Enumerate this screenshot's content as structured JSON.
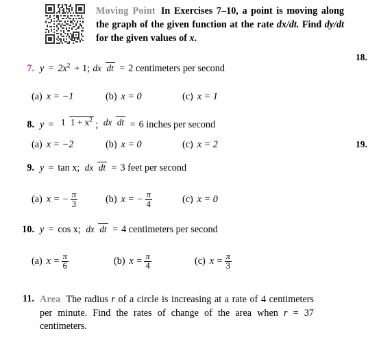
{
  "header": {
    "qr_alt": "qr-code",
    "category_label": "Moving Point",
    "line1_rest": "In Exercises 7–10, a point is",
    "line2": "moving along the graph of the given function at",
    "line3_a": "the rate ",
    "line3_math1": "dx/dt.",
    "line3_b": " Find ",
    "line3_math2": "dy/dt",
    "line3_c": " for the given values of ",
    "line3_var": "x",
    "line3_end": "."
  },
  "margin_numbers": {
    "first": "18.",
    "second": "19."
  },
  "exercises": [
    {
      "number": "7.",
      "y_label": "y",
      "equals": "=",
      "rhs": "2x",
      "exponent": "2",
      "plus_one": "+ 1;",
      "rate_num": "dx",
      "rate_den": "dt",
      "rate_equals": "=",
      "rate_value": "2 centimeters per second",
      "choices": [
        {
          "tag": "(a)",
          "expr": "x = −1"
        },
        {
          "tag": "(b)",
          "expr": "x = 0"
        },
        {
          "tag": "(c)",
          "expr": "x = 1"
        }
      ]
    },
    {
      "number": "8.",
      "y_label": "y",
      "equals": "=",
      "frac_num": "1",
      "frac_den": "1 + x",
      "frac_den_exp": "2",
      "semicolon": ";",
      "rate_num": "dx",
      "rate_den": "dt",
      "rate_equals": "=",
      "rate_value": "6 inches per second",
      "choices": [
        {
          "tag": "(a)",
          "expr": "x = −2"
        },
        {
          "tag": "(b)",
          "expr": "x = 0"
        },
        {
          "tag": "(c)",
          "expr": "x = 2"
        }
      ]
    },
    {
      "number": "9.",
      "y_label": "y",
      "equals": "=",
      "rhs": "tan x;",
      "rate_num": "dx",
      "rate_den": "dt",
      "rate_equals": "=",
      "rate_value": "3 feet per second",
      "choices": [
        {
          "tag": "(a)",
          "lead": "x = −",
          "num": "π",
          "den": "3"
        },
        {
          "tag": "(b)",
          "lead": "x = −",
          "num": "π",
          "den": "4"
        },
        {
          "tag": "(c)",
          "plain": "x = 0"
        }
      ]
    },
    {
      "number": "10.",
      "y_label": "y",
      "equals": "=",
      "rhs": "cos x;",
      "rate_num": "dx",
      "rate_den": "dt",
      "rate_equals": "=",
      "rate_value": "4 centimeters per second",
      "choices": [
        {
          "tag": "(a)",
          "lead": "x =",
          "num": "π",
          "den": "6"
        },
        {
          "tag": "(b)",
          "lead": "x =",
          "num": "π",
          "den": "4"
        },
        {
          "tag": "(c)",
          "lead": "x =",
          "num": "π",
          "den": "3"
        }
      ]
    }
  ],
  "exercise11": {
    "number": "11.",
    "category_label": "Area",
    "line1_a": "The radius ",
    "line1_var": "r",
    "line1_b": " of a circle is increasing at a rate of",
    "line2": "4 centimeters per minute. Find the rates of change of the area",
    "line3_a": "when ",
    "line3_var": "r",
    "line3_b": " = 37 centimeters."
  },
  "colors": {
    "accent_pink": "#c0389b",
    "category_gray": "#8d8d8d",
    "text": "#000000"
  }
}
